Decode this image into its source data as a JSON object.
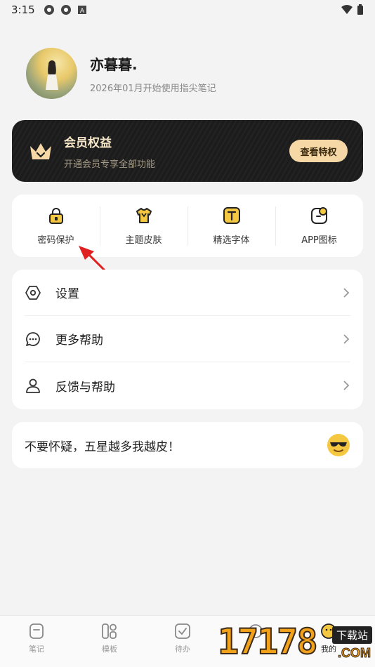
{
  "status_bar": {
    "time": "3:15"
  },
  "profile": {
    "name": "亦暮暮.",
    "since": "2026年01月开始使用指尖笔记"
  },
  "vip": {
    "title": "会员权益",
    "subtitle": "开通会员专享全部功能",
    "button": "查看特权",
    "accent": "#f6d8a6"
  },
  "quick_actions": [
    {
      "label": "密码保护",
      "icon": "lock-icon"
    },
    {
      "label": "主题皮肤",
      "icon": "tshirt-icon"
    },
    {
      "label": "精选字体",
      "icon": "font-icon"
    },
    {
      "label": "APP图标",
      "icon": "app-icon"
    }
  ],
  "menu": [
    {
      "label": "设置",
      "icon": "settings-icon"
    },
    {
      "label": "更多帮助",
      "icon": "chat-icon"
    },
    {
      "label": "反馈与帮助",
      "icon": "user-icon"
    }
  ],
  "slogan": {
    "text": "不要怀疑，五星越多我越皮！",
    "icon": "sunglasses-emoji-icon"
  },
  "tabs": [
    {
      "label": "笔记",
      "icon": "note-icon"
    },
    {
      "label": "模板",
      "icon": "template-icon"
    },
    {
      "label": "待办",
      "icon": "todo-icon"
    },
    {
      "label": "",
      "icon": "unknown-icon"
    },
    {
      "label": "我的",
      "icon": "profile-tab-icon"
    }
  ],
  "watermark": {
    "number": "17178",
    "tag": "下载站",
    "suffix": ".COM"
  },
  "colors": {
    "brand_yellow": "#f5c842",
    "background": "#f3f3f3",
    "arrow": "#e02020"
  }
}
